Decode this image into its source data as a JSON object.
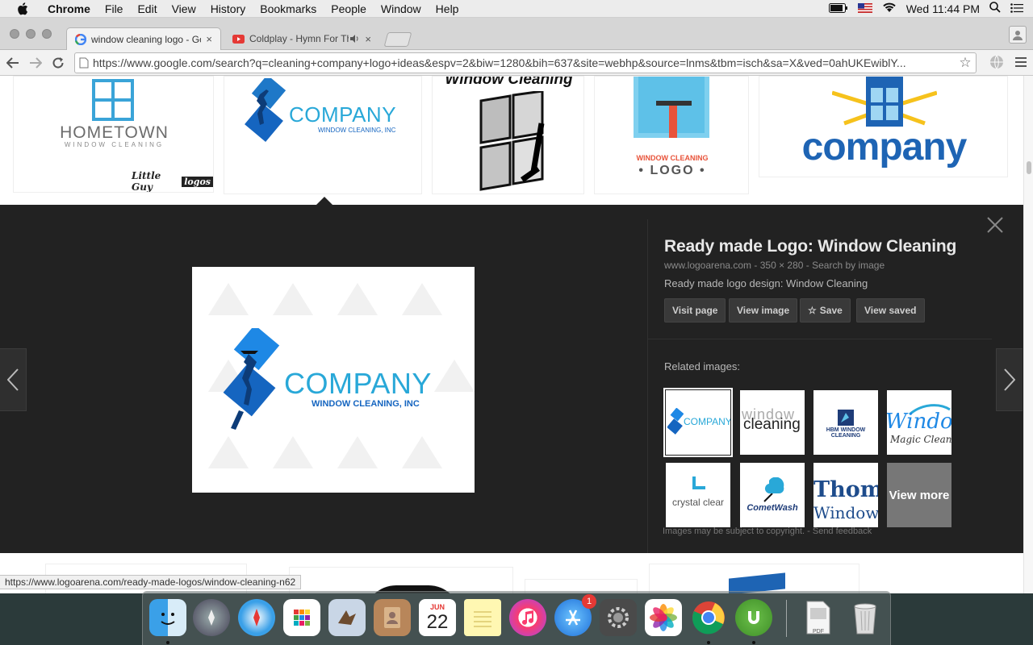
{
  "menubar": {
    "app_name": "Chrome",
    "items": [
      "File",
      "Edit",
      "View",
      "History",
      "Bookmarks",
      "People",
      "Window",
      "Help"
    ],
    "clock": "Wed 11:44 PM"
  },
  "tabs": [
    {
      "title": "window cleaning logo - Goo",
      "close": "×"
    },
    {
      "title": "Coldplay - Hymn For The",
      "close": "×"
    }
  ],
  "toolbar": {
    "url": "https://www.google.com/search?q=cleaning+company+logo+ideas&espv=2&biw=1280&bih=637&site=webhp&source=lnms&tbm=isch&sa=X&ved=0ahUKEwiblY..."
  },
  "results_top": {
    "hometown_name": "HOMETOWN",
    "hometown_sub": "WINDOW CLEANING",
    "little_guy_1": "Little Guy",
    "little_guy_2": "logos",
    "company_name": "COMPANY",
    "company_sub": "WINDOW CLEANING, INC",
    "window_cleaning_header": "Window Cleaning",
    "wc_logo_line1": "WINDOW CLEANING",
    "wc_logo_line2": "• LOGO •",
    "big_company": "company"
  },
  "panel": {
    "title": "Ready made Logo: Window Cleaning",
    "meta": "www.logoarena.com - 350 × 280 - Search by image",
    "description": "Ready made logo design: Window Cleaning",
    "actions": {
      "visit_page": "Visit page",
      "view_image": "View image",
      "save": "Save",
      "view_saved": "View saved"
    },
    "related_label": "Related images:",
    "related": {
      "r1": "COMPANY",
      "r2a": "window",
      "r2b": "cleaning",
      "r3": "HBM WINDOW CLEANING",
      "r4a": "Windo",
      "r4b": "Magic Clean",
      "r5a": "crystal clear",
      "r6": "CometWash",
      "r7a": "Thom",
      "r7b": "Window"
    },
    "view_more": "View more",
    "footer": "Images may be subject to copyright. - Send feedback",
    "main_company": "COMPANY",
    "main_sub": "WINDOW CLEANING, INC"
  },
  "status_url": "https://www.logoarena.com/ready-made-logos/window-cleaning-n62",
  "dock": {
    "calendar_month": "JUN",
    "calendar_day": "22",
    "appstore_badge": "1",
    "pdf_label": "PDF"
  }
}
